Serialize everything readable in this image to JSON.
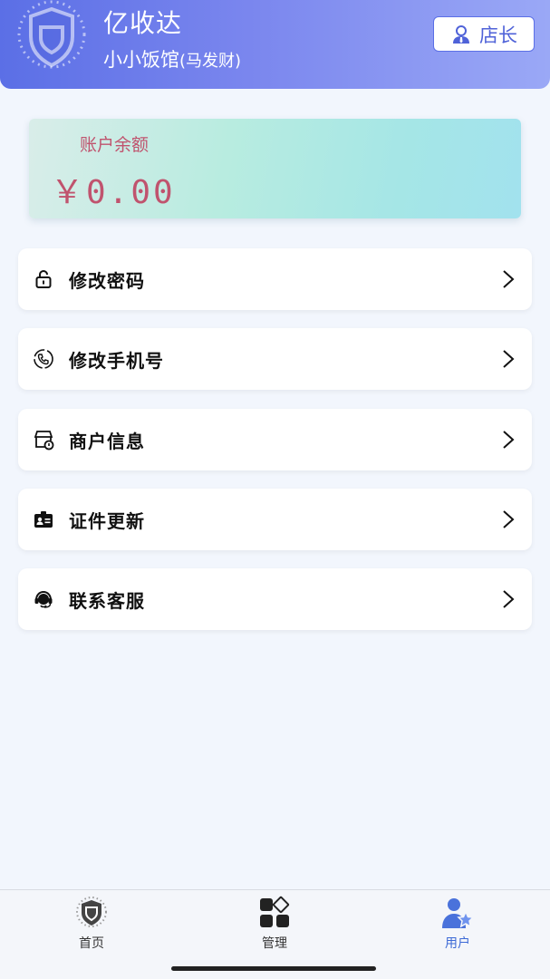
{
  "header": {
    "app_title": "亿收达",
    "shop_name": "小小饭馆",
    "owner": "(马发财)",
    "role_label": "店长"
  },
  "balance": {
    "label": "账户余额",
    "value": "￥0.00"
  },
  "menu": [
    {
      "label": "修改密码",
      "icon": "lock-icon"
    },
    {
      "label": "修改手机号",
      "icon": "phone-icon"
    },
    {
      "label": "商户信息",
      "icon": "store-icon"
    },
    {
      "label": "证件更新",
      "icon": "id-card-icon"
    },
    {
      "label": "联系客服",
      "icon": "headset-icon"
    }
  ],
  "tabbar": {
    "items": [
      {
        "label": "首页",
        "icon": "shield-icon"
      },
      {
        "label": "管理",
        "icon": "grid-icon"
      },
      {
        "label": "用户",
        "icon": "user-star-icon"
      }
    ],
    "active_index": 2
  },
  "colors": {
    "primary": "#5b6fe6",
    "balance_text": "#c0536e",
    "tab_active": "#3d6ad6"
  }
}
